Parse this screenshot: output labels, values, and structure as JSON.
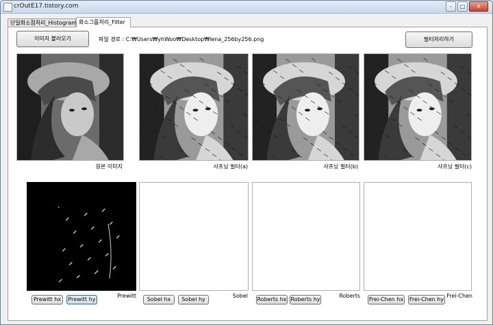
{
  "window": {
    "title": "crOutE17.tistory.com",
    "controls": {
      "minimize": "–",
      "maximize": "□",
      "close": "✕"
    }
  },
  "tabs": [
    {
      "label": "단일화소점처리_Histogram",
      "active": false
    },
    {
      "label": "화소그룹처리_Filter",
      "active": true
    }
  ],
  "toolbar": {
    "load_label": "이미지 불러오기",
    "path_text": "파일 경로 : C:₩Users₩yhWoo₩Desktop₩lena_256by256.png",
    "filter_label": "필터처리하기"
  },
  "top_images": [
    {
      "caption": "원본 이미지",
      "kind": "original"
    },
    {
      "caption": "샤프닝 필터(a)",
      "kind": "sharpened"
    },
    {
      "caption": "샤프닝 필터(b)",
      "kind": "sharpened"
    },
    {
      "caption": "샤프닝 필터(c)",
      "kind": "sharpened"
    }
  ],
  "edge_panels": [
    {
      "caption": "Prewitt",
      "buttons": [
        "Prewitt hx",
        "Prewitt hy"
      ],
      "focused": 1,
      "filled": true
    },
    {
      "caption": "Sobel",
      "buttons": [
        "Sobel hx",
        "Sobel hy"
      ],
      "focused": -1,
      "filled": false
    },
    {
      "caption": "Roberts",
      "buttons": [
        "Roberts hx",
        "Roberts hy"
      ],
      "focused": -1,
      "filled": false
    },
    {
      "caption": "Frei-Chen",
      "buttons": [
        "Frei-Chen hx",
        "Frei-Chen hy"
      ],
      "focused": -1,
      "filled": false
    }
  ],
  "colors": {
    "accent": "#3c7fb1",
    "tab_bg": "#ffffff",
    "window_bg": "#f0f0f0"
  }
}
